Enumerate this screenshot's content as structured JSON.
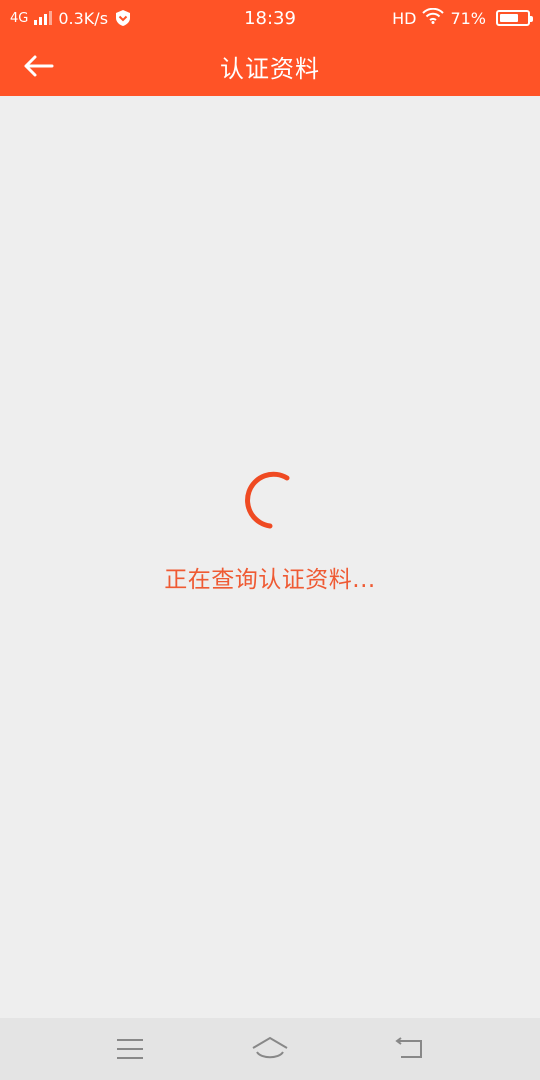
{
  "status_bar": {
    "network_type": "4G",
    "speed": "0.3K/s",
    "time": "18:39",
    "hd": "HD",
    "battery_percent": "71%",
    "battery_level": 0.71
  },
  "header": {
    "title": "认证资料"
  },
  "loading": {
    "message": "正在查询认证资料..."
  },
  "colors": {
    "accent": "#ff5326",
    "text_accent": "#ef5a33",
    "background": "#eeeeee"
  },
  "icons": {
    "back": "arrow-left-icon",
    "menu": "menu-icon",
    "home": "home-icon",
    "return": "back-icon"
  }
}
